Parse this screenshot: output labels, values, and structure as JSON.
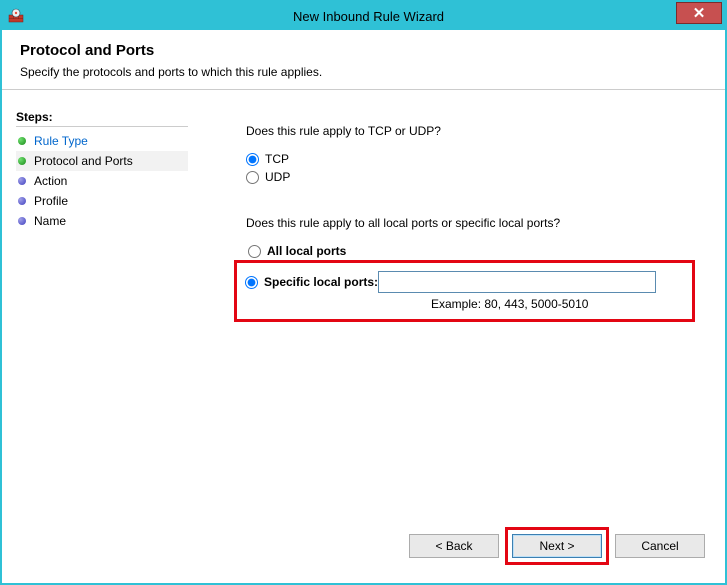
{
  "window": {
    "title": "New Inbound Rule Wizard",
    "close_label": "✕"
  },
  "header": {
    "title": "Protocol and Ports",
    "subtitle": "Specify the protocols and ports to which this rule applies."
  },
  "steps": {
    "header": "Steps:",
    "items": [
      {
        "label": "Rule Type",
        "state": "done",
        "link": true,
        "current": false
      },
      {
        "label": "Protocol and Ports",
        "state": "done",
        "link": false,
        "current": true
      },
      {
        "label": "Action",
        "state": "pending",
        "link": false,
        "current": false
      },
      {
        "label": "Profile",
        "state": "pending",
        "link": false,
        "current": false
      },
      {
        "label": "Name",
        "state": "pending",
        "link": false,
        "current": false
      }
    ]
  },
  "main": {
    "q1": "Does this rule apply to TCP or UDP?",
    "proto_tcp": "TCP",
    "proto_udp": "UDP",
    "q2": "Does this rule apply to all local ports or specific local ports?",
    "opt_all": "All local ports",
    "opt_specific": "Specific local ports:",
    "port_value": "",
    "port_placeholder": "",
    "example": "Example: 80, 443, 5000-5010"
  },
  "buttons": {
    "back": "< Back",
    "next": "Next >",
    "cancel": "Cancel"
  }
}
